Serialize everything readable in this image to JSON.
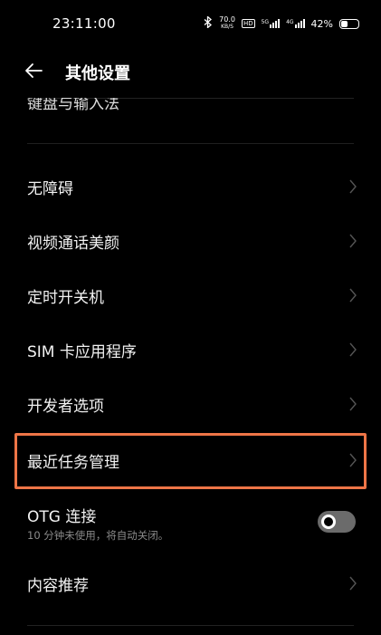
{
  "status_bar": {
    "time": "23:11:00",
    "bluetooth_icon": "bluetooth-icon",
    "speed_value": "70.0",
    "speed_unit": "KB/S",
    "hd_badge": "HD",
    "network_1": "5G",
    "network_2": "4G",
    "battery_percent": "42%",
    "battery_level": 0.42
  },
  "header": {
    "back_icon": "arrow-left-icon",
    "title": "其他设置"
  },
  "cut_off_item": {
    "label": "键盘与输入法"
  },
  "rows": [
    {
      "label": "无障碍"
    },
    {
      "label": "视频通话美颜"
    },
    {
      "label": "定时开关机"
    },
    {
      "label": "SIM 卡应用程序"
    },
    {
      "label": "开发者选项"
    },
    {
      "label": "最近任务管理"
    }
  ],
  "otg": {
    "title": "OTG 连接",
    "subtitle": "10 分钟未使用，将自动关闭。",
    "enabled": false
  },
  "content_recommend": {
    "label": "内容推荐"
  },
  "colors": {
    "background": "#000000",
    "highlight": "#ee7547",
    "toggle_off": "#6b6b6b"
  }
}
